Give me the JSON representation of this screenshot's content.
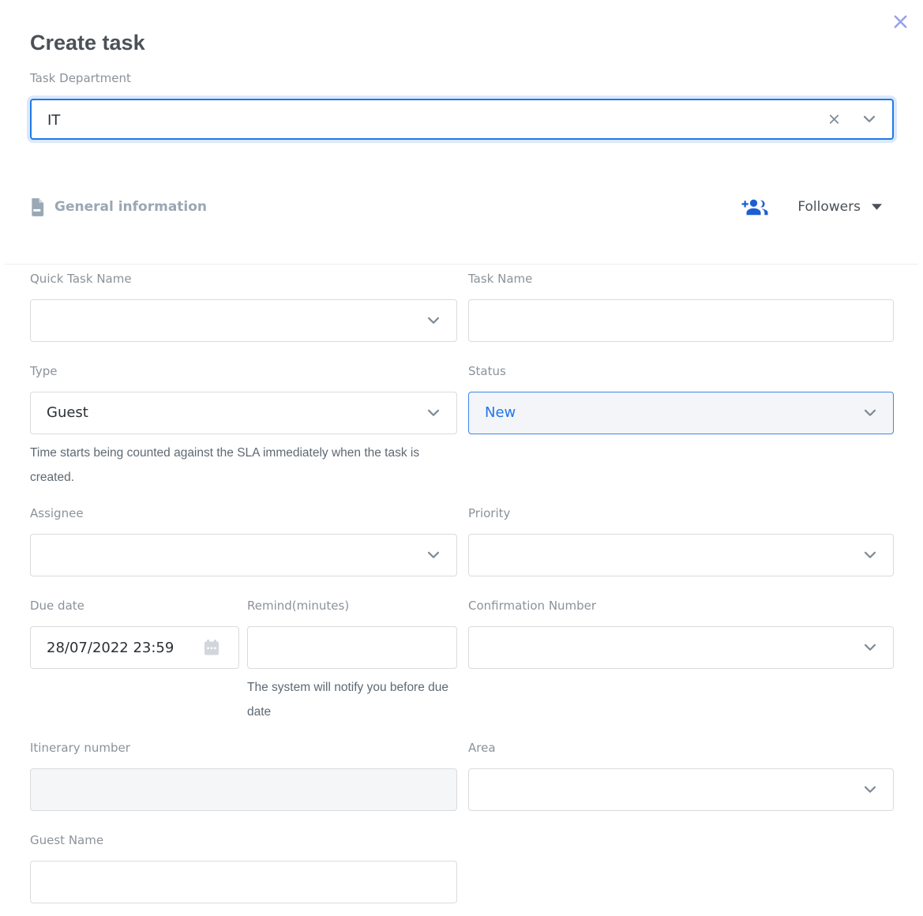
{
  "modal": {
    "title": "Create task"
  },
  "task_department": {
    "label": "Task Department",
    "value": "IT"
  },
  "section": {
    "icon": "document-icon",
    "title": "General information",
    "followers": {
      "icon": "person-add-icon",
      "label": "Followers",
      "caret": "caret-down-icon"
    }
  },
  "fields": {
    "quick_task_name": {
      "label": "Quick Task Name",
      "value": ""
    },
    "task_name": {
      "label": "Task Name",
      "value": ""
    },
    "type": {
      "label": "Type",
      "value": "Guest",
      "helper": "Time starts being counted against the SLA immediately when the task is created."
    },
    "status": {
      "label": "Status",
      "value": "New"
    },
    "assignee": {
      "label": "Assignee",
      "value": ""
    },
    "priority": {
      "label": "Priority",
      "value": ""
    },
    "due_date": {
      "label": "Due date",
      "value": "28/07/2022 23:59",
      "icon": "calendar-icon"
    },
    "remind": {
      "label": "Remind(minutes)",
      "value": "",
      "helper": "The system will notify you before due date"
    },
    "confirmation_number": {
      "label": "Confirmation Number",
      "value": ""
    },
    "itinerary_number": {
      "label": "Itinerary number",
      "value": "",
      "disabled": true
    },
    "area": {
      "label": "Area",
      "value": ""
    },
    "guest_name": {
      "label": "Guest Name",
      "value": ""
    }
  },
  "colors": {
    "accent_blue": "#2079e8",
    "status_text": "#2376e8",
    "status_bg": "#f3f5f8",
    "close_icon": "#97a1e9",
    "followers_icon": "#1d5fd2",
    "section_title": "#9aa7b4",
    "border_default": "#d8dbde",
    "label_gray": "#8b929a"
  }
}
